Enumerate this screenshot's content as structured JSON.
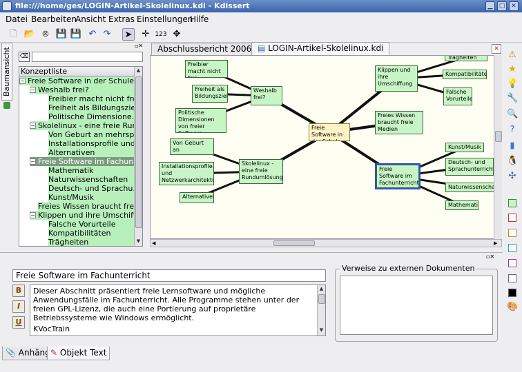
{
  "window": {
    "title": "file:///home/ges/LOGIN-Artikel-Skolelinux.kdi - Kdissert"
  },
  "menu": [
    "Datei",
    "Bearbeiten",
    "Ansicht",
    "Extras",
    "Einstellungen",
    "Hilfe"
  ],
  "toolbar": {
    "zoom_label": "123"
  },
  "left_vtab": {
    "label": "Baumansicht"
  },
  "tree": {
    "header": "Konzeptliste",
    "search_placeholder": "",
    "rows": [
      {
        "label": "Freie Software in der Schule",
        "level": 0,
        "expander": "−"
      },
      {
        "label": "Weshalb frei?",
        "level": 1,
        "expander": "−"
      },
      {
        "label": "Freibier macht nicht frei",
        "level": 2,
        "expander": ""
      },
      {
        "label": "Freiheit als Bildungsziel",
        "level": 2,
        "expander": ""
      },
      {
        "label": "Politische Dimensione...",
        "level": 2,
        "expander": ""
      },
      {
        "label": "Skolelinux - eine freie Run...",
        "level": 1,
        "expander": "−"
      },
      {
        "label": "Von Geburt an mehrsp...",
        "level": 2,
        "expander": ""
      },
      {
        "label": "Installationsprofile und ...",
        "level": 2,
        "expander": ""
      },
      {
        "label": "Alternativen",
        "level": 2,
        "expander": ""
      },
      {
        "label": "Freie Software im Fachun...",
        "level": 1,
        "expander": "−",
        "selected": true
      },
      {
        "label": "Mathematik",
        "level": 2,
        "expander": ""
      },
      {
        "label": "Naturwissenschaften",
        "level": 2,
        "expander": ""
      },
      {
        "label": "Deutsch- und Sprachu...",
        "level": 2,
        "expander": ""
      },
      {
        "label": "Kunst/Musik",
        "level": 2,
        "expander": ""
      },
      {
        "label": "Freies Wissen braucht frei...",
        "level": 1,
        "expander": ""
      },
      {
        "label": "Klippen und ihre Umschiff...",
        "level": 1,
        "expander": "−"
      },
      {
        "label": "Falsche Vorurteile",
        "level": 2,
        "expander": ""
      },
      {
        "label": "Kompatibilitäten",
        "level": 2,
        "expander": ""
      },
      {
        "label": "Trägheiten",
        "level": 2,
        "expander": ""
      }
    ]
  },
  "tabs": [
    {
      "label": "Abschlussbericht 2006.kdi",
      "active": false
    },
    {
      "label": "LOGIN-Artikel-Skolelinux.kdi",
      "active": true
    }
  ],
  "mindmap": {
    "center": "Freie Software in der Schule",
    "nodes": [
      {
        "key": "freibier",
        "label": "Freibier macht nicht frei"
      },
      {
        "key": "freiheit",
        "label": "Freiheit als Bildungsziel"
      },
      {
        "key": "politische",
        "label": "Politische Dimensionen von freier Software"
      },
      {
        "key": "weshalb",
        "label": "Weshalb frei?"
      },
      {
        "key": "klippen",
        "label": "Klippen und ihre Umschiffung"
      },
      {
        "key": "traegheiten",
        "label": "Trägheiten"
      },
      {
        "key": "kompat",
        "label": "Kompatibilitäten"
      },
      {
        "key": "falsche",
        "label": "Falsche Vorurteile"
      },
      {
        "key": "freieswissen",
        "label": "Freies Wissen braucht freie Medien"
      },
      {
        "key": "geburt",
        "label": "Von Geburt an mehrsprachig"
      },
      {
        "key": "install",
        "label": "Installationsprofile und Netzwerkarchitektur"
      },
      {
        "key": "alternativen",
        "label": "Alternativen"
      },
      {
        "key": "skolelinux",
        "label": "Skolelinux - eine freie Rundumlösung"
      },
      {
        "key": "fachunterricht",
        "label": "Freie Software im Fachunterricht",
        "selected": true
      },
      {
        "key": "kunst",
        "label": "Kunst/Musik"
      },
      {
        "key": "deutsch",
        "label": "Deutsch- und Sprachunterricht"
      },
      {
        "key": "naturwiss",
        "label": "Naturwissenschaften"
      },
      {
        "key": "mathe",
        "label": "Mathematik"
      }
    ]
  },
  "properties": {
    "title_value": "Freie Software im Fachunterricht",
    "format_buttons": [
      "B",
      "I",
      "U"
    ],
    "description": "Dieser Abschnitt präsentiert freie Lernsoftware und mögliche Anwendungsfälle im Fachunterricht. Alle Programme stehen unter der freien GPL-Lizenz, die auch eine Portierung auf proprietäre Betriebssysteme wie Windows ermöglicht.",
    "description_extra": "KVocTrain",
    "refs_label": "Verweise zu externen Dokumenten"
  },
  "bottom_tabs": [
    {
      "label": "Anhänge",
      "active": false
    },
    {
      "label": "Objekt Text",
      "active": true
    }
  ],
  "colors": {
    "node_fill": "#c8f5c6",
    "center_fill": "#fdf3c4",
    "tree_sel": "#7c9c7e",
    "title_bar": "#3a64ad"
  }
}
